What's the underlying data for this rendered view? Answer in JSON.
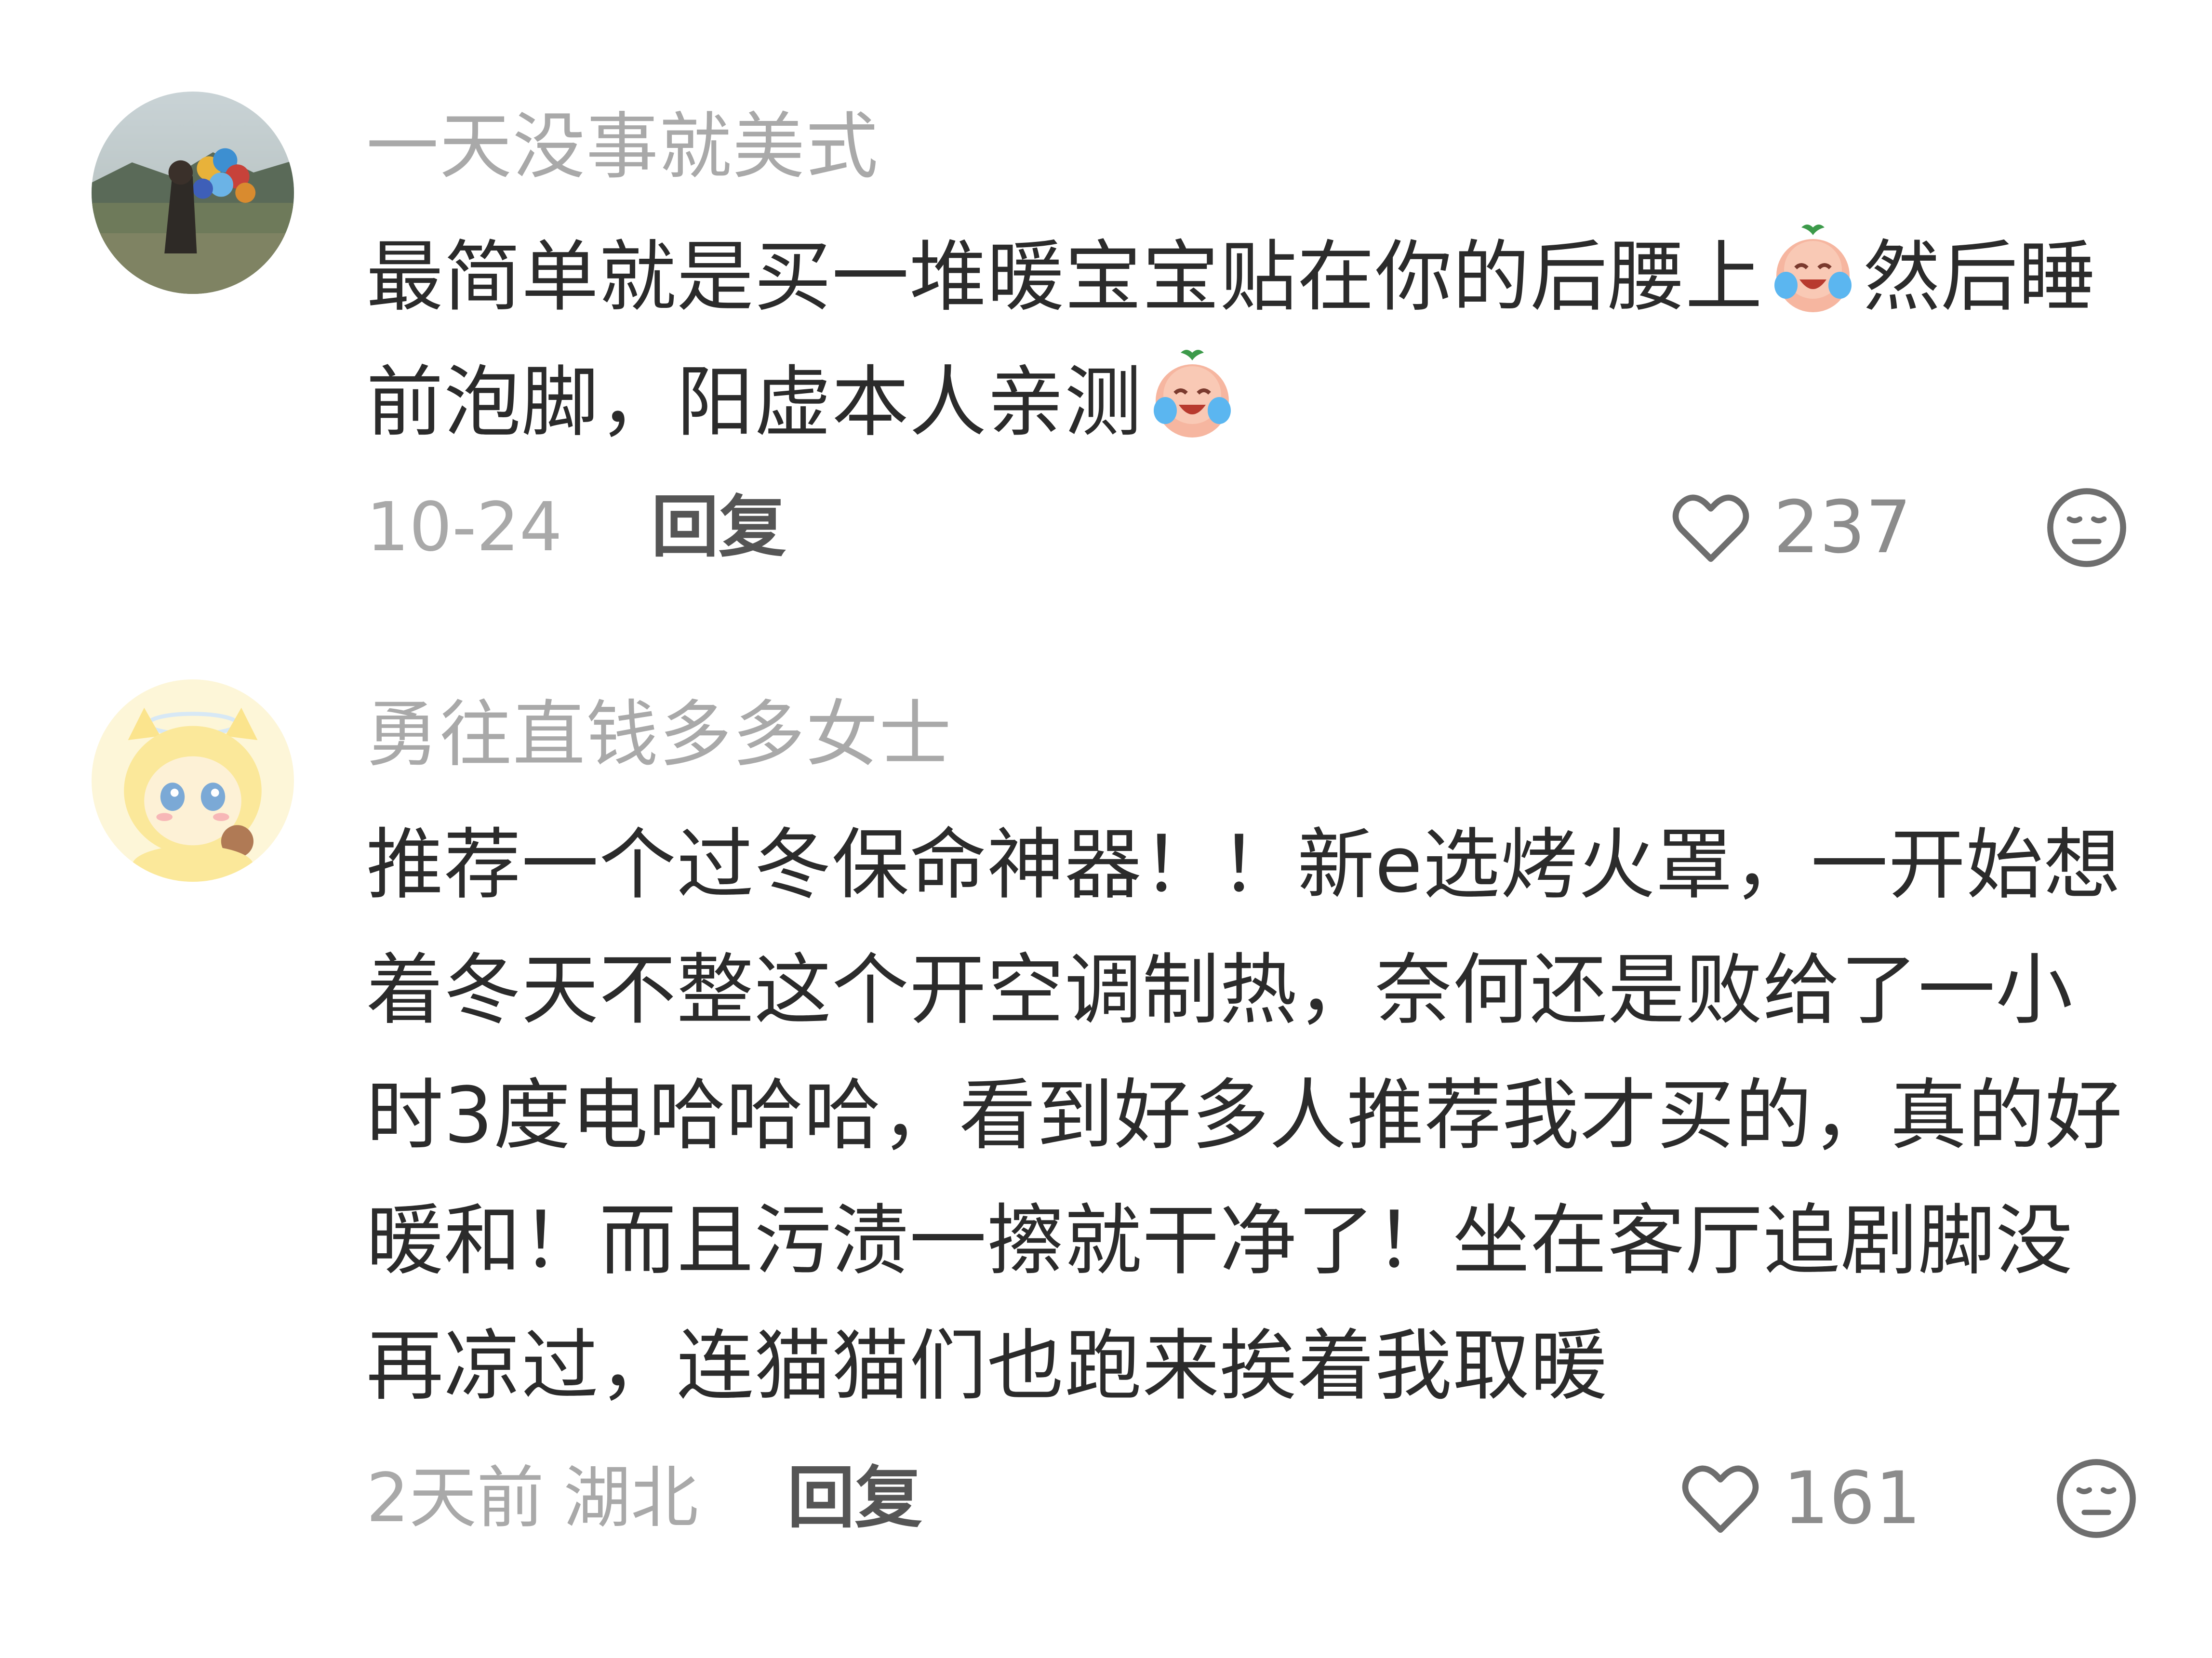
{
  "comments": [
    {
      "username": "一天没事就美式",
      "text_parts": [
        "最简单就是买一堆暖宝宝贴在你的后腰上",
        "然后睡前泡脚，阳虚本人亲测",
        ""
      ],
      "emoji_1": "laughing-crying-peach-icon",
      "emoji_2": "laughing-crying-peach-icon",
      "date": "10-24",
      "location": "",
      "reply_label": "回复",
      "likes": "237"
    },
    {
      "username": "勇往直钱多多女士",
      "text": "推荐一个过冬保命神器！！新e选烤火罩，一开始想着冬天不整这个开空调制热，奈何还是败给了一小时3度电哈哈哈，看到好多人推荐我才买的，真的好暖和！而且污渍一擦就干净了！坐在客厅追剧脚没再凉过，连猫猫们也跑来挨着我取暖",
      "date": "2天前",
      "location": "湖北",
      "reply_label": "回复",
      "likes": "161"
    }
  ],
  "icons": {
    "like": "heart-outline-icon",
    "dislike": "meh-face-icon"
  },
  "colors": {
    "username": "#a9a9a9",
    "body": "#2b2b2b",
    "meta": "#a9a9a9",
    "reply": "#555555",
    "icon": "#6e6e6e"
  }
}
